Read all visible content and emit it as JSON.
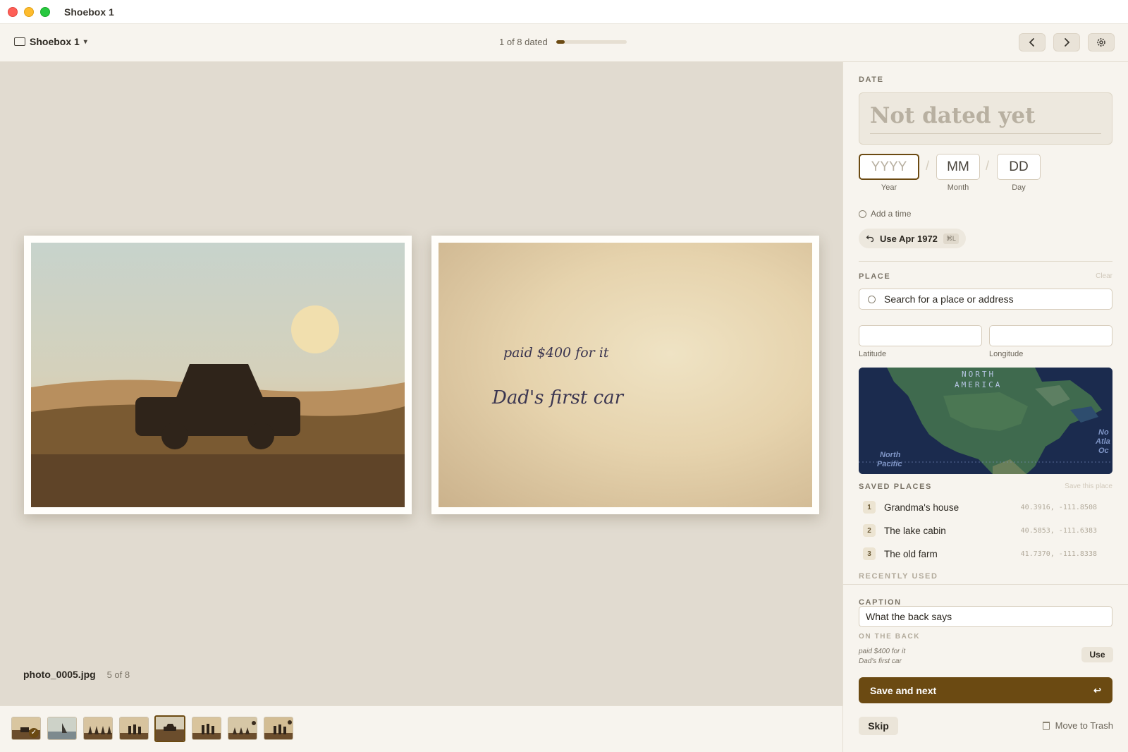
{
  "window": {
    "title": "Shoebox 1"
  },
  "toolbar": {
    "library_name": "Shoebox 1",
    "progress_text": "1 of 8 dated",
    "progress_fraction": 0.125,
    "prev_icon": "chevron-left-icon",
    "next_icon": "chevron-right-icon",
    "settings_icon": "gear-icon"
  },
  "viewer": {
    "back_lines": [
      "paid $400 for it",
      "Dad's first car"
    ],
    "file_name": "photo_0005.jpg",
    "position": "5 of 8"
  },
  "filmstrip": {
    "count": 8,
    "active_index": 4,
    "checked_index": 0
  },
  "date": {
    "section_label": "DATE",
    "display": "Not dated yet",
    "year_placeholder": "YYYY",
    "month_placeholder": "MM",
    "day_placeholder": "DD",
    "year_caption": "Year",
    "month_caption": "Month",
    "day_caption": "Day",
    "add_time": "Add a time",
    "suggestion": "Use Apr 1972",
    "suggestion_shortcut": "⌘L"
  },
  "place": {
    "section_label": "PLACE",
    "clear": "Clear",
    "search_placeholder": "Search for a place or address",
    "lat_caption": "Latitude",
    "lon_caption": "Longitude",
    "map_labels": [
      "NORTH",
      "AMERICA",
      "North",
      "Pacific",
      "No",
      "Atla",
      "Oc"
    ]
  },
  "saved_places": {
    "section_label": "SAVED PLACES",
    "save_this": "Save this place",
    "items": [
      {
        "num": "1",
        "name": "Grandma's house",
        "coords": "40.3916, -111.8508"
      },
      {
        "num": "2",
        "name": "The lake cabin",
        "coords": "40.5853, -111.6383"
      },
      {
        "num": "3",
        "name": "The old farm",
        "coords": "41.7370, -111.8338"
      }
    ],
    "recent_label": "RECENTLY USED"
  },
  "caption": {
    "section_label": "CAPTION",
    "value": "What the back says",
    "on_back_label": "ON THE BACK",
    "on_back_lines": [
      "paid $400 for it",
      "Dad's first car"
    ],
    "use_label": "Use",
    "save_next": "Save and next",
    "enter_icon": "return-key-icon",
    "skip": "Skip",
    "trash": "Move to Trash"
  },
  "colors": {
    "accent": "#6b4a12",
    "panel_bg": "#f7f4ee",
    "viewer_bg": "#e1dbd0"
  }
}
